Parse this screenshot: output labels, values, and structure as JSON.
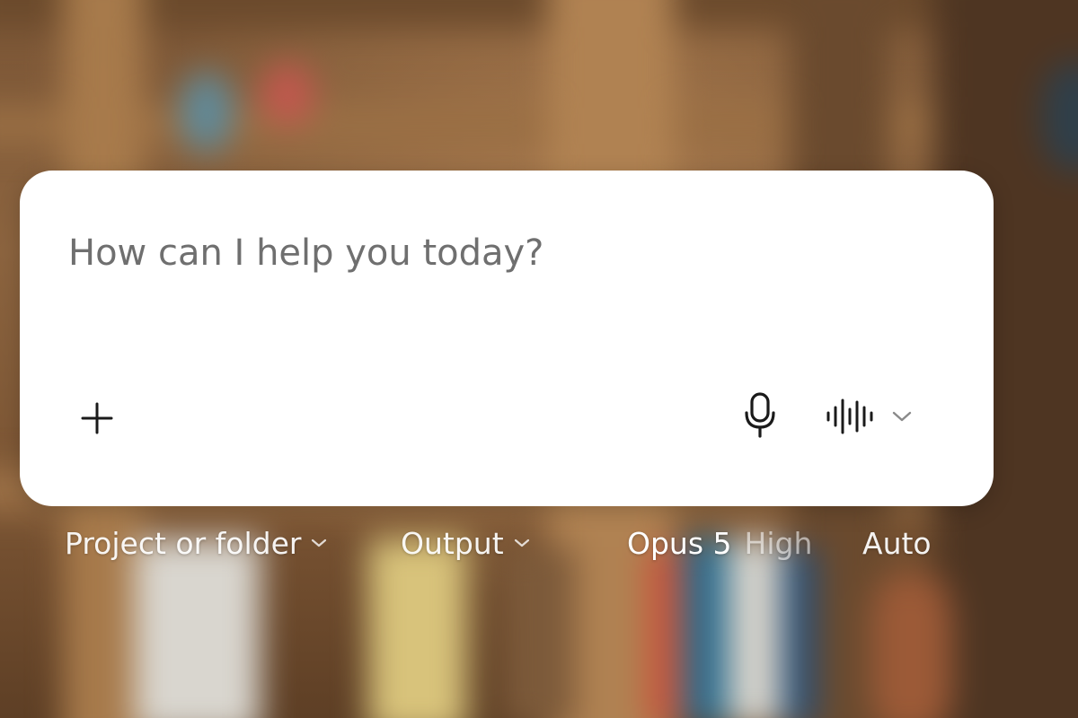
{
  "composer": {
    "placeholder": "How can I help you today?",
    "value": ""
  },
  "icons": {
    "add": "plus-icon",
    "microphone": "microphone-icon",
    "voice": "audio-waveform-icon",
    "voice_menu": "chevron-down-icon"
  },
  "controls": {
    "project_label": "Project or folder",
    "output_label": "Output",
    "model_label": "Opus 5",
    "effort_label": "High",
    "mode_label": "Auto"
  },
  "colors": {
    "card": "#ffffff",
    "placeholder_text": "#6f6f6f",
    "control_text": "#ffffff"
  }
}
